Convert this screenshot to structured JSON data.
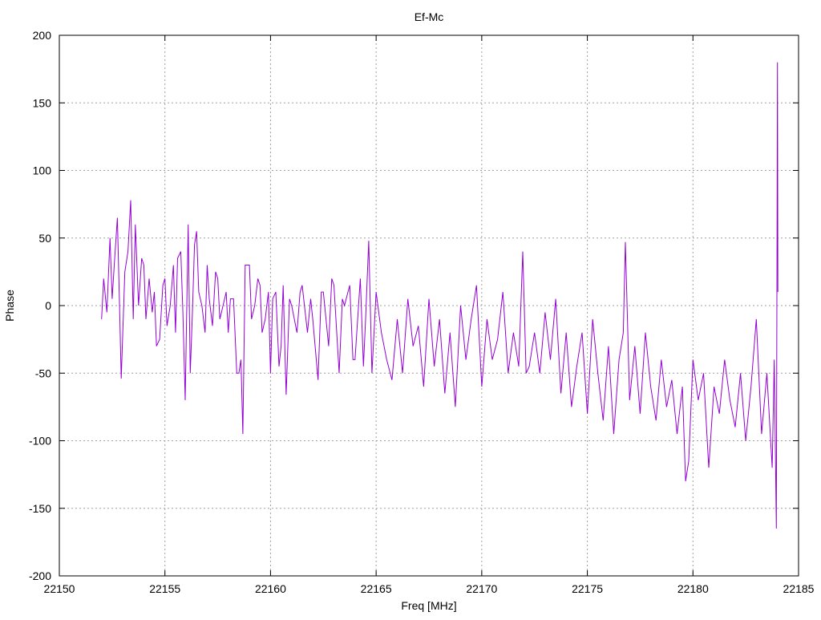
{
  "chart_data": {
    "type": "line",
    "title": "Ef-Mc",
    "xlabel": "Freq [MHz]",
    "ylabel": "Phase",
    "xlim": [
      22150,
      22185
    ],
    "ylim": [
      -200,
      200
    ],
    "xticks": [
      "22150",
      "22155",
      "22160",
      "22165",
      "22170",
      "22175",
      "22180",
      "22185"
    ],
    "yticks": [
      "-200",
      "-150",
      "-100",
      "-50",
      "0",
      "50",
      "100",
      "150",
      "200"
    ],
    "grid": true,
    "series": [
      {
        "name": "Ef-Mc",
        "color": "#9400d3",
        "x": [
          22152.0,
          22152.1,
          22152.25,
          22152.4,
          22152.5,
          22152.6,
          22152.75,
          22152.85,
          22152.93,
          22153.1,
          22153.25,
          22153.38,
          22153.5,
          22153.6,
          22153.75,
          22153.9,
          22154.0,
          22154.1,
          22154.25,
          22154.4,
          22154.5,
          22154.6,
          22154.75,
          22154.9,
          22155.0,
          22155.1,
          22155.25,
          22155.4,
          22155.5,
          22155.6,
          22155.75,
          22155.85,
          22155.96,
          22156.1,
          22156.2,
          22156.3,
          22156.4,
          22156.5,
          22156.6,
          22156.75,
          22156.9,
          22157.0,
          22157.1,
          22157.25,
          22157.4,
          22157.5,
          22157.6,
          22157.75,
          22157.9,
          22158.0,
          22158.1,
          22158.25,
          22158.4,
          22158.5,
          22158.6,
          22158.69,
          22158.8,
          22159.0,
          22159.1,
          22159.25,
          22159.4,
          22159.5,
          22159.6,
          22159.75,
          22159.9,
          22160.0,
          22160.1,
          22160.25,
          22160.4,
          22160.5,
          22160.6,
          22160.74,
          22160.9,
          22161.0,
          22161.25,
          22161.4,
          22161.5,
          22161.75,
          22161.9,
          22162.0,
          22162.25,
          22162.4,
          22162.5,
          22162.75,
          22162.9,
          22163.0,
          22163.25,
          22163.4,
          22163.5,
          22163.75,
          22163.9,
          22164.0,
          22164.25,
          22164.4,
          22164.5,
          22164.65,
          22164.8,
          22165.0,
          22165.25,
          22165.5,
          22165.75,
          22166.0,
          22166.25,
          22166.5,
          22166.75,
          22167.0,
          22167.25,
          22167.5,
          22167.75,
          22168.0,
          22168.25,
          22168.5,
          22168.75,
          22169.0,
          22169.25,
          22169.5,
          22169.75,
          22170.0,
          22170.25,
          22170.5,
          22170.75,
          22171.0,
          22171.25,
          22171.5,
          22171.75,
          22171.94,
          22172.1,
          22172.25,
          22172.5,
          22172.75,
          22173.0,
          22173.25,
          22173.5,
          22173.75,
          22174.0,
          22174.25,
          22174.5,
          22174.75,
          22175.0,
          22175.25,
          22175.5,
          22175.75,
          22176.0,
          22176.25,
          22176.5,
          22176.7,
          22176.8,
          22177.0,
          22177.25,
          22177.5,
          22177.75,
          22178.0,
          22178.25,
          22178.5,
          22178.75,
          22179.0,
          22179.25,
          22179.5,
          22179.65,
          22179.8,
          22180.0,
          22180.25,
          22180.5,
          22180.75,
          22181.0,
          22181.25,
          22181.5,
          22181.75,
          22182.0,
          22182.25,
          22182.5,
          22182.75,
          22183.0,
          22183.25,
          22183.5,
          22183.75,
          22183.85,
          22183.95,
          22184.0,
          22184.02
        ],
        "y": [
          -10,
          20,
          -5,
          50,
          5,
          30,
          65,
          0,
          -54,
          25,
          40,
          78,
          -10,
          60,
          0,
          35,
          30,
          -10,
          20,
          -5,
          10,
          -30,
          -25,
          15,
          20,
          -15,
          0,
          30,
          -20,
          35,
          40,
          -5,
          -70,
          60,
          -50,
          -5,
          45,
          55,
          10,
          0,
          -20,
          30,
          5,
          -15,
          25,
          20,
          -10,
          0,
          10,
          -20,
          5,
          5,
          -50,
          -50,
          -40,
          -95,
          30,
          30,
          -10,
          0,
          20,
          15,
          -20,
          -10,
          10,
          -50,
          5,
          10,
          -45,
          -30,
          15,
          -66,
          5,
          0,
          -20,
          10,
          15,
          -20,
          5,
          -10,
          -55,
          10,
          10,
          -30,
          20,
          15,
          -50,
          5,
          0,
          15,
          -40,
          -40,
          20,
          -45,
          -10,
          48,
          -50,
          10,
          -20,
          -40,
          -55,
          -10,
          -50,
          5,
          -30,
          -15,
          -60,
          5,
          -45,
          -10,
          -65,
          -20,
          -75,
          0,
          -40,
          -10,
          15,
          -60,
          -10,
          -40,
          -25,
          10,
          -50,
          -20,
          -45,
          40,
          -50,
          -45,
          -20,
          -50,
          -5,
          -40,
          5,
          -65,
          -20,
          -75,
          -45,
          -20,
          -80,
          -10,
          -50,
          -85,
          -30,
          -95,
          -40,
          -20,
          47,
          -70,
          -30,
          -80,
          -20,
          -60,
          -85,
          -40,
          -75,
          -55,
          -95,
          -60,
          -130,
          -115,
          -40,
          -70,
          -50,
          -120,
          -60,
          -80,
          -40,
          -70,
          -90,
          -50,
          -100,
          -60,
          -10,
          -95,
          -50,
          -120,
          -40,
          -165,
          180,
          10
        ]
      }
    ]
  }
}
